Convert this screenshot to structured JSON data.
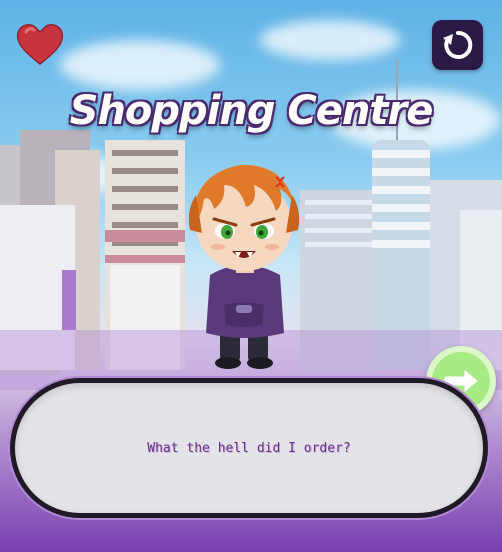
{
  "scene": {
    "location_title": "Shopping Centre"
  },
  "controls": {
    "heart_icon": "heart-icon",
    "restart_icon": "restart-icon",
    "next_icon": "arrow-right-icon"
  },
  "dialogue": {
    "text": "What the hell did I order?"
  },
  "colors": {
    "heart": "#c8343e",
    "restart_bg": "#2b1a45",
    "next_bg": "#a8ea84",
    "dialogue_text": "#6a2f8a",
    "dialogue_border": "#1f1a26"
  }
}
